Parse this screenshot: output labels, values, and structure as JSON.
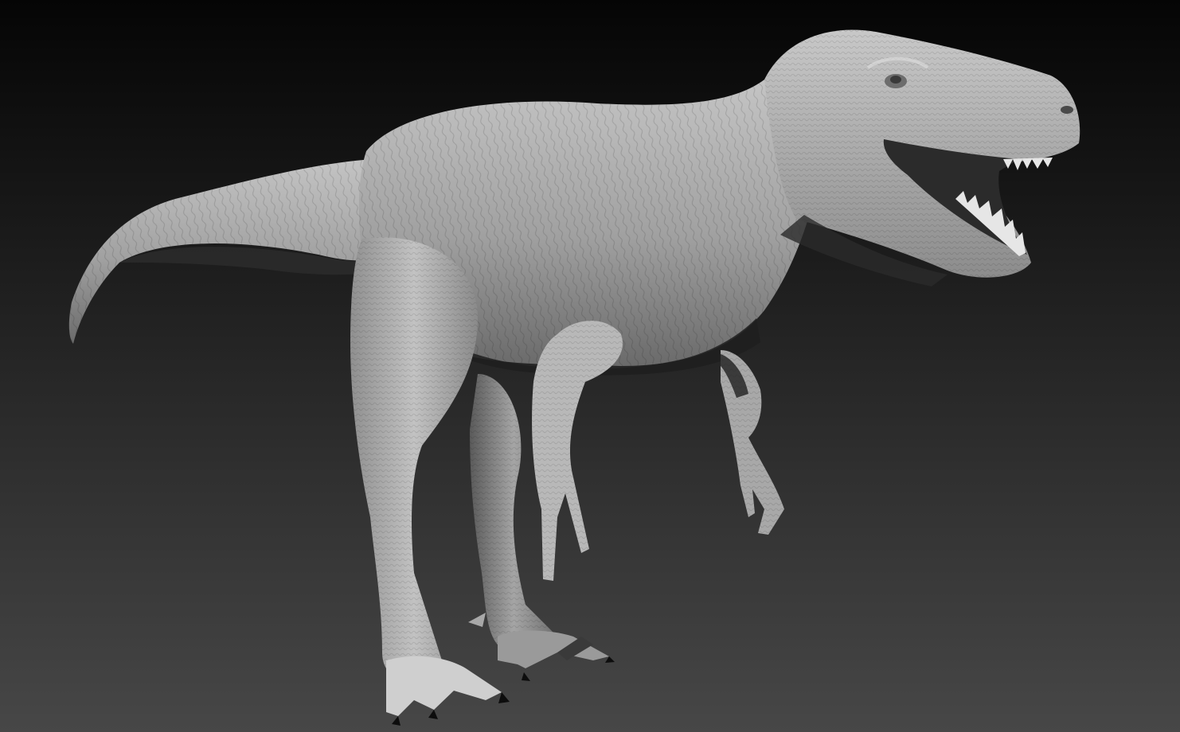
{
  "scene": {
    "subject": "t-rex-sculpt",
    "render_style": "grayscale-clay",
    "background_gradient": {
      "top": "#050505",
      "bottom": "#474747"
    },
    "colors": {
      "skin_base": "#9a9a9a",
      "skin_light": "#c9c9c9",
      "skin_shadow": "#3a3a3a",
      "claw": "#0d0d0d",
      "teeth": "#e6e6e6",
      "mouth_interior": "#2b2b2b"
    }
  }
}
